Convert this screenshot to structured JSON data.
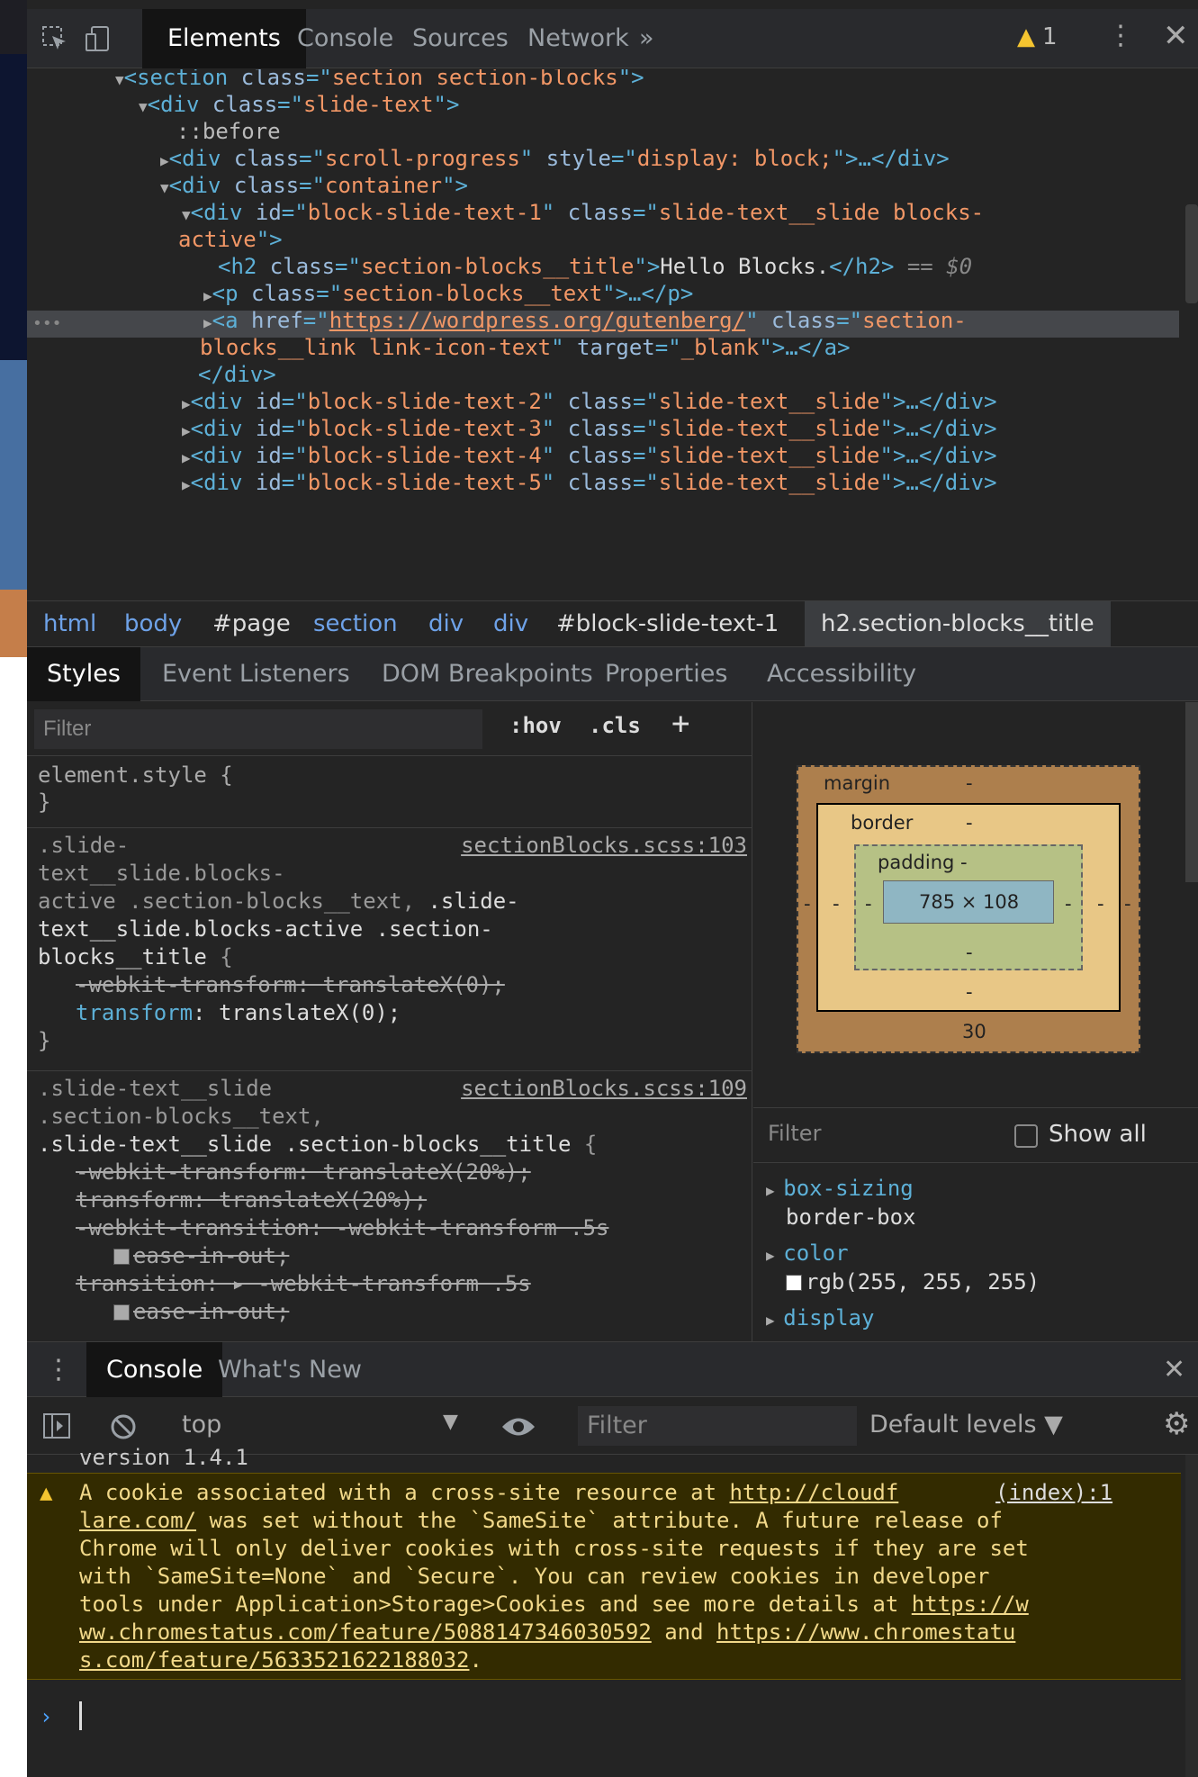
{
  "toolbar": {
    "tabs": [
      "Elements",
      "Console",
      "Sources",
      "Network"
    ],
    "more": "»",
    "warn_count": "1",
    "kebab": "⋮",
    "close": "✕"
  },
  "tree": {
    "l1a": "▼",
    "l1b": "<section ",
    "l1c": "class",
    "l1d": "=\"",
    "l1e": "section section-blocks",
    "l1f": "\">",
    "l2": "<div ",
    "l2c": "class",
    "l2v": "slide-text",
    "l3": "::before",
    "l4a": "<div ",
    "l4c": "class",
    "l4v": "scroll-progress",
    "l4s": "style",
    "l4sv": "display: block;",
    "l4end": "…</div>",
    "l5v": "container",
    "l6id": "id",
    "l6idv": "block-slide-text-1",
    "l6c": "class",
    "l6cv": "slide-text__slide blocks-",
    "l7": "active\">",
    "l8a": "<h2 ",
    "l8c": "class",
    "l8v": "section-blocks__title",
    "l8t": "Hello Blocks.",
    "l8e": "</h2>",
    "l8eq": "== ",
    "l8d": "$0",
    "l9c": "class",
    "l9v": "section-blocks__text",
    "l9e": "…</p>",
    "l10h": "href",
    "l10hv": "https://wordpress.org/gutenberg/",
    "l10c": "class",
    "l10cv": "section-",
    "l11v": "blocks__link link-icon-text",
    "l11t": "target",
    "l11tv": "_blank",
    "l11e": "…</a>",
    "l12": "</div>",
    "rows": [
      "block-slide-text-2",
      "block-slide-text-3",
      "block-slide-text-4",
      "block-slide-text-5"
    ],
    "rowclass": "slide-text__slide",
    "rowend": "…</div>",
    "dots": "•••"
  },
  "crumbs": [
    "html",
    "body",
    "#page",
    "section",
    "div",
    "div",
    "#block-slide-text-1",
    "h2.section-blocks__title"
  ],
  "styles_tabs": [
    "Styles",
    "Event Listeners",
    "DOM Breakpoints",
    "Properties",
    "Accessibility"
  ],
  "styles": {
    "filter_placeholder": "Filter",
    "hov": ":hov",
    "cls": ".cls",
    "plus": "+",
    "r0a": "element.style {",
    "r0b": "}",
    "r1src": "sectionBlocks.scss:103",
    "r1l1": ".slide-",
    "r1l2": "text__slide.blocks-",
    "r1l3a": "active .section-blocks__text, ",
    "r1l3b": ".slide-",
    "r1l4": "text__slide.blocks-active .section-",
    "r1l5a": "blocks__title",
    "r1l5b": " {",
    "r1p1": "-webkit-transform",
    "r1v1": "translateX(0);",
    "r1p2": "transform",
    "r1v2": "translateX(0);",
    "r1end": "}",
    "r2src": "sectionBlocks.scss:109",
    "r2l1": ".slide-text__slide",
    "r2l2": ".section-blocks__text,",
    "r2l3a": ".slide-text__slide .section-blocks__title",
    "r2l3b": " {",
    "r2p1": "-webkit-transform",
    "r2v1": "translateX(20%);",
    "r2p2": "transform",
    "r2v2": "translateX(20%);",
    "r2p3": "-webkit-transition",
    "r2v3": "-webkit-transform .5s",
    "r2v3b": "ease-in-out;",
    "r2p4": "transition",
    "r2v4": "▸ -webkit-transform .5s",
    "r2v4b": "ease-in-out;"
  },
  "boxmodel": {
    "margin": "margin",
    "margin_top": "-",
    "margin_bottom": "30",
    "margin_left": "-",
    "margin_right": "-",
    "border": "border",
    "border_top": "-",
    "border_bottom": "-",
    "border_left": "-",
    "border_right": "-",
    "padding": "padding -",
    "padding_bottom": "-",
    "padding_left": "-",
    "padding_right": "-",
    "content": "785 × 108"
  },
  "computed": {
    "filter": "Filter",
    "show_all": "Show all",
    "p1": "box-sizing",
    "v1": "border-box",
    "p2": "color",
    "v2": "rgb(255, 255, 255)",
    "p3": "display"
  },
  "drawer": {
    "tabs": [
      "Console",
      "What's New"
    ],
    "close": "✕",
    "context": "top",
    "filter": "Filter",
    "levels": "Default levels ▼"
  },
  "console": {
    "version": "version 1.4.1",
    "source": "(index):1",
    "w1a": "A cookie associated with a cross-site resource at ",
    "w1link": "http://cloudf",
    "w2link": "lare.com/",
    "w2b": " was set without the `SameSite` attribute. A future release of",
    "w3": "Chrome will only deliver cookies with cross-site requests if they are set",
    "w4": "with `SameSite=None` and `Secure`. You can review cookies in developer",
    "w5a": "tools under Application>Storage>Cookies and see more details at ",
    "w5link": "https://w",
    "w6link": "ww.chromestatus.com/feature/5088147346030592",
    "w6b": " and ",
    "w6link2": "https://www.chromestatu",
    "w7link": "s.com/feature/5633521622188032",
    "w7b": ".",
    "prompt": "›"
  },
  "colors": {
    "accent": "#6ea2e8",
    "warning": "#f4c430",
    "tag": "#5db0d7",
    "value": "#f29766"
  }
}
